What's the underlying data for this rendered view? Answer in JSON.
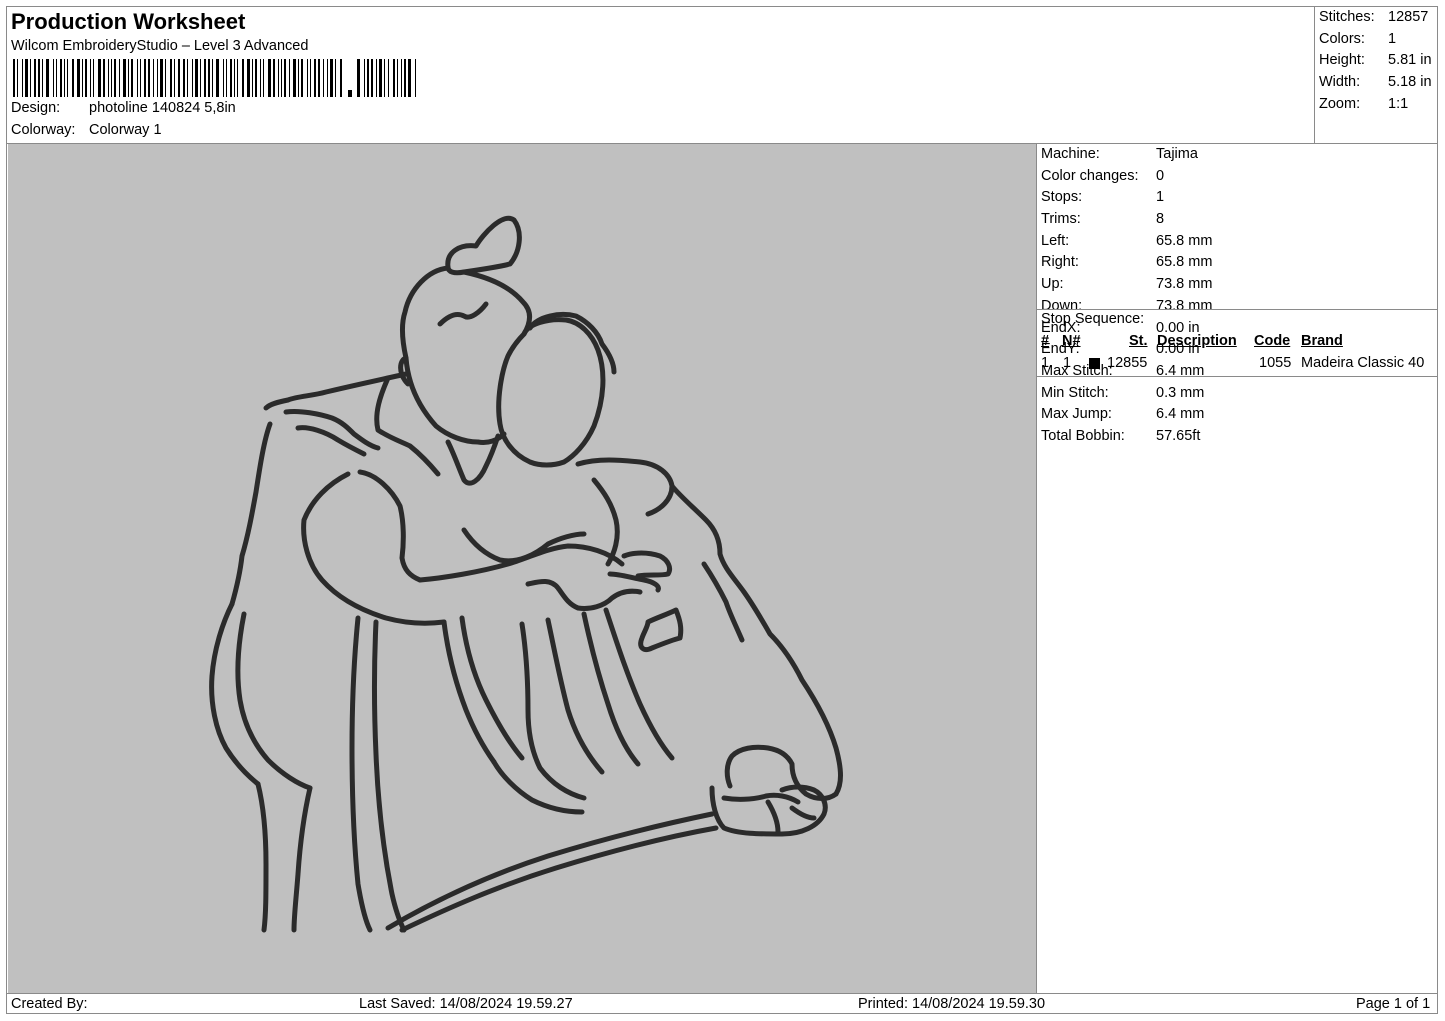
{
  "header": {
    "title": "Production Worksheet",
    "subtitle": "Wilcom EmbroideryStudio – Level 3 Advanced",
    "barcode_icon": "barcode-icon",
    "design_label": "Design:",
    "design_value": "photoline 140824 5,8in",
    "colorway_label": "Colorway:",
    "colorway_value": "Colorway 1"
  },
  "summary": [
    {
      "label": "Stitches:",
      "value": "12857"
    },
    {
      "label": "Colors:",
      "value": "1"
    },
    {
      "label": "Height:",
      "value": "5.81 in"
    },
    {
      "label": "Width:",
      "value": "5.18 in"
    },
    {
      "label": "Zoom:",
      "value": "1:1"
    }
  ],
  "properties": [
    {
      "label": "Machine:",
      "value": "Tajima"
    },
    {
      "label": "Color changes:",
      "value": "0"
    },
    {
      "label": "Stops:",
      "value": "1"
    },
    {
      "label": "Trims:",
      "value": "8"
    },
    {
      "label": "Left:",
      "value": "65.8 mm"
    },
    {
      "label": "Right:",
      "value": "65.8 mm"
    },
    {
      "label": "Up:",
      "value": "73.8 mm"
    },
    {
      "label": "Down:",
      "value": "73.8 mm"
    },
    {
      "label": "EndX:",
      "value": "0.00 in"
    },
    {
      "label": "EndY:",
      "value": "0.00 in"
    },
    {
      "label": "Max Stitch:",
      "value": "6.4 mm"
    },
    {
      "label": "Min Stitch:",
      "value": "0.3 mm"
    },
    {
      "label": "Max Jump:",
      "value": "6.4 mm"
    },
    {
      "label": "Total Bobbin:",
      "value": "57.65ft"
    }
  ],
  "stop_sequence": {
    "title": "Stop Sequence:",
    "headers": {
      "index": "#",
      "needle": "N#",
      "stitches": "St.",
      "description": "Description",
      "code": "Code",
      "brand": "Brand"
    },
    "rows": [
      {
        "index": "1.",
        "needle": "1",
        "swatch_color": "#000000",
        "stitches": "12855",
        "description": "",
        "code": "1055",
        "brand": "Madeira Classic 40"
      }
    ]
  },
  "design_preview": {
    "background_color": "#c0c0c0",
    "stitch_color": "#2b2b2b",
    "subject": "line-art-embrace-icon"
  },
  "footer": {
    "created_by": "Created By:",
    "last_saved": "Last Saved: 14/08/2024 19.59.27",
    "printed": "Printed: 14/08/2024 19.59.30",
    "page": "Page 1 of 1"
  }
}
